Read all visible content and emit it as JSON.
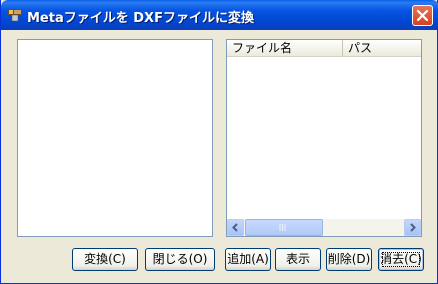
{
  "window": {
    "title": "Metaファイルを DXFファイルに変換"
  },
  "list_view": {
    "columns": [
      "ファイル名",
      "パス"
    ],
    "scroll_grip": "III"
  },
  "buttons": {
    "convert": "変換(C)",
    "close": "閉じる(O)",
    "add": "追加(A)",
    "display": "表示",
    "delete": "削除(D)",
    "clear": "消去(C)"
  },
  "colors": {
    "titlebar": "#0555e2",
    "close_button": "#d8401d",
    "border": "#7f9db9"
  }
}
